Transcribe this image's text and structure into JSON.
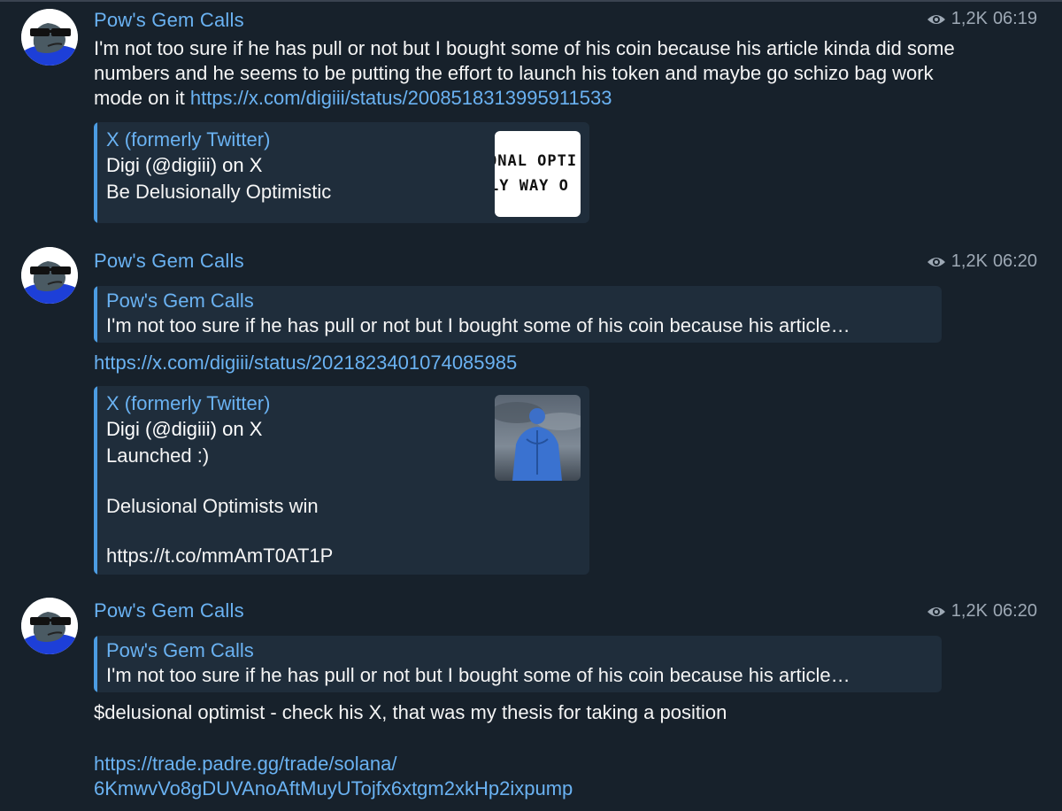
{
  "channel_name": "Pow's Gem Calls",
  "colors": {
    "background": "#17212b",
    "accent": "#6ab2f2",
    "card": "#1f2d3b",
    "bar": "#4c9ce2",
    "meta": "#9ea9b5"
  },
  "messages": [
    {
      "sender": "Pow's Gem Calls",
      "views": "1,2K",
      "time": "06:19",
      "text": "I'm not too sure if he has pull or not but I bought some of his coin because his article kinda did some numbers and he seems to be putting the effort to launch his token and maybe go schizo bag work mode on it",
      "link": "https://x.com/digiii/status/2008518313995911533",
      "preview": {
        "site": "X (formerly Twitter)",
        "title": "Digi (@digiii) on X",
        "description": "Be Delusionally Optimistic",
        "thumb_line1": "ONAL OPTI",
        "thumb_line2": "LY WAY O"
      }
    },
    {
      "sender": "Pow's Gem Calls",
      "views": "1,2K",
      "time": "06:20",
      "reply": {
        "name": "Pow's Gem Calls",
        "text": "I'm not too sure if he has pull or not but I bought some of his coin because his article…"
      },
      "link": "https://x.com/digiii/status/2021823401074085985",
      "preview": {
        "site": "X (formerly Twitter)",
        "title": "Digi (@digiii) on X",
        "description_line1": "Launched :)",
        "description_line2": "Delusional Optimists win",
        "description_link": "https://t.co/mmAmT0AT1P"
      }
    },
    {
      "sender": "Pow's Gem Calls",
      "views": "1,2K",
      "time": "06:20",
      "reply": {
        "name": "Pow's Gem Calls",
        "text": "I'm not too sure if he has pull or not but I bought some of his coin because his article…"
      },
      "text": "$delusional optimist - check his X, that was my thesis for taking a position",
      "link_line1": "https://trade.padre.gg/trade/solana/",
      "link_line2": "6KmwvVo8gDUVAnoAftMuyUTojfx6xtgm2xkHp2ixpump"
    }
  ]
}
